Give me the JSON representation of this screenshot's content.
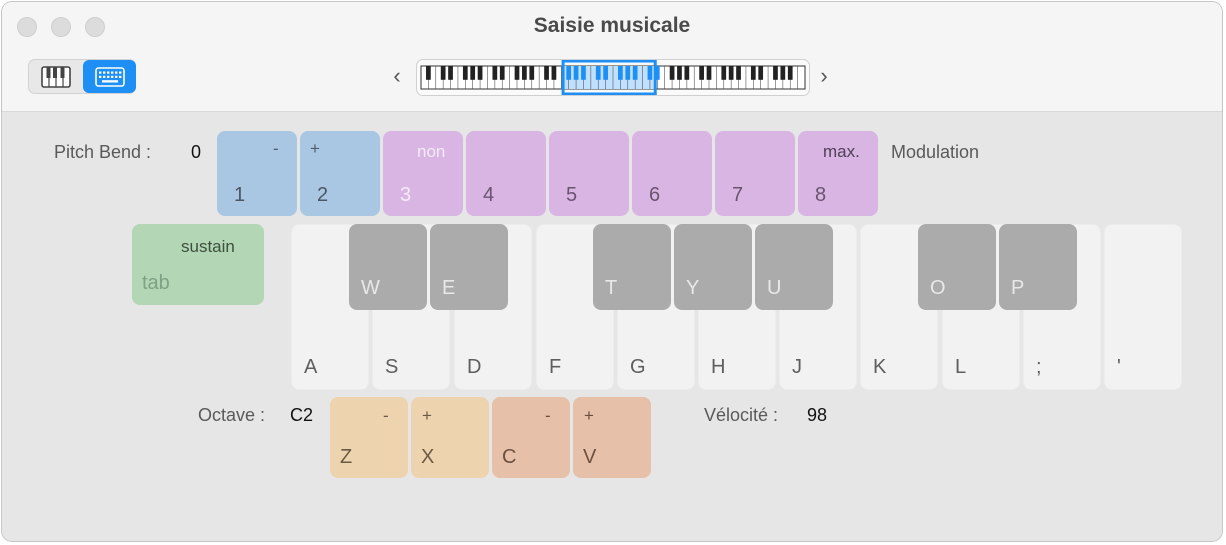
{
  "window": {
    "title": "Saisie musicale"
  },
  "toolbar": {
    "view_buttons": [
      {
        "icon": "piano-keys-icon",
        "active": false
      },
      {
        "icon": "computer-keyboard-icon",
        "active": true
      }
    ],
    "prev_label": "‹",
    "next_label": "›",
    "range_selector": {
      "visible_range_fraction": 0.24,
      "start_fraction": 0.37
    }
  },
  "colors": {
    "accent": "#1e8ff5",
    "pitch_bend": "#a9c6e2",
    "modulation": "#d9b5e3",
    "sustain": "#b3d7b5",
    "octave": "#edd4ae",
    "velocity": "#e6c0a8"
  },
  "pitch_bend": {
    "label": "Pitch Bend :",
    "value": "0",
    "keys": [
      {
        "key": "1",
        "sub": "-"
      },
      {
        "key": "2",
        "sub": "+"
      }
    ]
  },
  "modulation": {
    "label": "Modulation",
    "keys": [
      {
        "key": "3",
        "sub": "non"
      },
      {
        "key": "4",
        "sub": ""
      },
      {
        "key": "5",
        "sub": ""
      },
      {
        "key": "6",
        "sub": ""
      },
      {
        "key": "7",
        "sub": ""
      },
      {
        "key": "8",
        "sub": "max."
      }
    ]
  },
  "sustain": {
    "key": "tab",
    "sub": "sustain"
  },
  "white_keys": [
    "A",
    "S",
    "D",
    "F",
    "G",
    "H",
    "J",
    "K",
    "L",
    ";",
    "'"
  ],
  "black_keys": [
    "W",
    "E",
    "T",
    "Y",
    "U",
    "O",
    "P"
  ],
  "octave": {
    "label": "Octave :",
    "value": "C2",
    "keys": [
      {
        "key": "Z",
        "sub": "-"
      },
      {
        "key": "X",
        "sub": "+"
      }
    ]
  },
  "velocity": {
    "label": "Vélocité :",
    "value": "98",
    "keys": [
      {
        "key": "C",
        "sub": "-"
      },
      {
        "key": "V",
        "sub": "+"
      }
    ]
  }
}
